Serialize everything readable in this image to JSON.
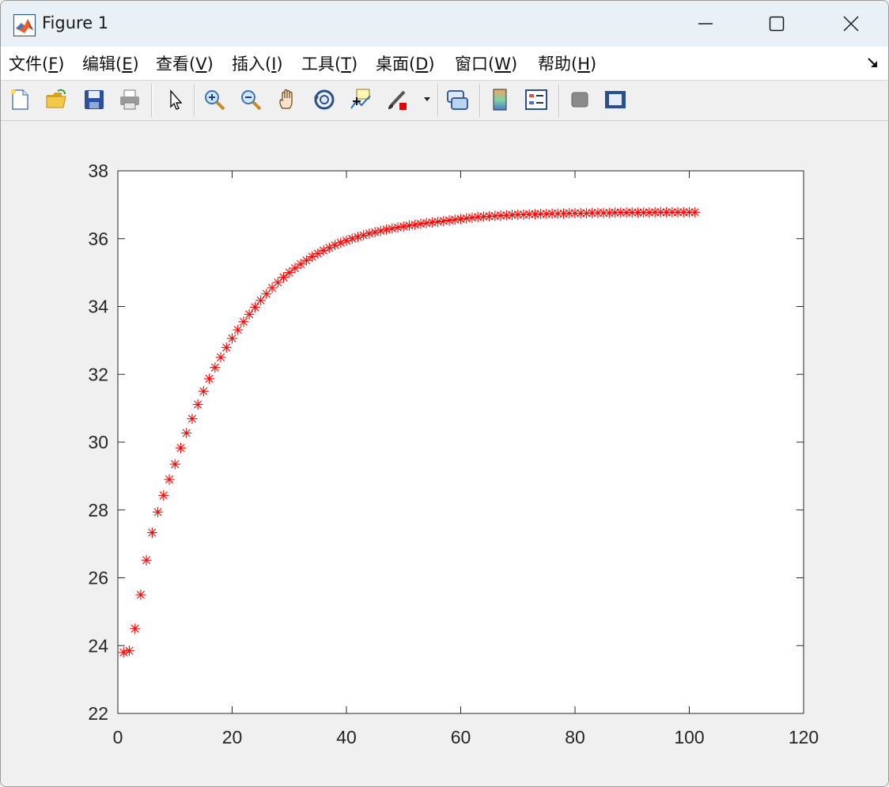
{
  "window": {
    "title": "Figure 1",
    "icon": "matlab-logo-icon",
    "controls": [
      "minimize-icon",
      "maximize-icon",
      "close-icon"
    ]
  },
  "menu": {
    "items": [
      {
        "label": "文件(",
        "key": "F",
        "tail": ")"
      },
      {
        "label": "编辑(",
        "key": "E",
        "tail": ")"
      },
      {
        "label": "查看(",
        "key": "V",
        "tail": ")"
      },
      {
        "label": "插入(",
        "key": "I",
        "tail": ")"
      },
      {
        "label": "工具(",
        "key": "T",
        "tail": ")"
      },
      {
        "label": "桌面(",
        "key": "D",
        "tail": ")"
      },
      {
        "label": "窗口(",
        "key": "W",
        "tail": ")"
      },
      {
        "label": "帮助(",
        "key": "H",
        "tail": ")"
      }
    ],
    "dock_icon": "dock-arrow-icon"
  },
  "toolbar": {
    "buttons": [
      "new-figure-icon",
      "open-file-icon",
      "save-icon",
      "print-icon",
      "edit-plot-arrow-icon",
      "zoom-in-icon",
      "zoom-out-icon",
      "pan-hand-icon",
      "rotate-3d-icon",
      "data-cursor-icon",
      "brush-icon",
      "brush-dropdown-icon",
      "link-plot-icon",
      "colorbar-icon",
      "legend-icon",
      "hide-plot-tools-icon",
      "show-plot-tools-icon"
    ]
  },
  "chart_data": {
    "type": "scatter",
    "marker": "*",
    "color": "#ff0000",
    "xlim": [
      0,
      120
    ],
    "ylim": [
      22,
      38
    ],
    "xticks": [
      "0",
      "20",
      "40",
      "60",
      "80",
      "100",
      "120"
    ],
    "yticks": [
      "22",
      "24",
      "26",
      "28",
      "30",
      "32",
      "34",
      "36",
      "38"
    ],
    "x": [
      1,
      2,
      3,
      4,
      5,
      6,
      7,
      8,
      9,
      10,
      11,
      12,
      13,
      14,
      15,
      16,
      17,
      18,
      19,
      20,
      21,
      22,
      23,
      24,
      25,
      26,
      27,
      28,
      29,
      30,
      31,
      32,
      33,
      34,
      35,
      36,
      37,
      38,
      39,
      40,
      41,
      42,
      43,
      44,
      45,
      46,
      47,
      48,
      49,
      50,
      51,
      52,
      53,
      54,
      55,
      56,
      57,
      58,
      59,
      60,
      61,
      62,
      63,
      64,
      65,
      66,
      67,
      68,
      69,
      70,
      71,
      72,
      73,
      74,
      75,
      76,
      77,
      78,
      79,
      80,
      81,
      82,
      83,
      84,
      85,
      86,
      87,
      88,
      89,
      90,
      91,
      92,
      93,
      94,
      95,
      96,
      97,
      98,
      99,
      100,
      101
    ],
    "y": [
      23.8,
      23.85,
      24.5,
      25.5,
      26.52,
      27.33,
      27.94,
      28.43,
      28.9,
      29.35,
      29.83,
      30.27,
      30.69,
      31.11,
      31.5,
      31.87,
      32.2,
      32.5,
      32.79,
      33.06,
      33.31,
      33.55,
      33.77,
      33.98,
      34.18,
      34.37,
      34.55,
      34.71,
      34.86,
      35.0,
      35.13,
      35.25,
      35.36,
      35.47,
      35.56,
      35.65,
      35.73,
      35.81,
      35.88,
      35.94,
      36.0,
      36.05,
      36.1,
      36.15,
      36.19,
      36.23,
      36.27,
      36.3,
      36.33,
      36.36,
      36.39,
      36.41,
      36.44,
      36.46,
      36.48,
      36.5,
      36.52,
      36.54,
      36.56,
      36.58,
      36.6,
      36.62,
      36.64,
      36.65,
      36.66,
      36.67,
      36.68,
      36.69,
      36.7,
      36.71,
      36.71,
      36.72,
      36.72,
      36.73,
      36.73,
      36.74,
      36.74,
      36.74,
      36.75,
      36.75,
      36.75,
      36.75,
      36.76,
      36.76,
      36.76,
      36.76,
      36.77,
      36.77,
      36.77,
      36.77,
      36.77,
      36.77,
      36.77,
      36.78,
      36.78,
      36.78,
      36.78,
      36.78,
      36.78,
      36.78,
      36.78
    ]
  }
}
